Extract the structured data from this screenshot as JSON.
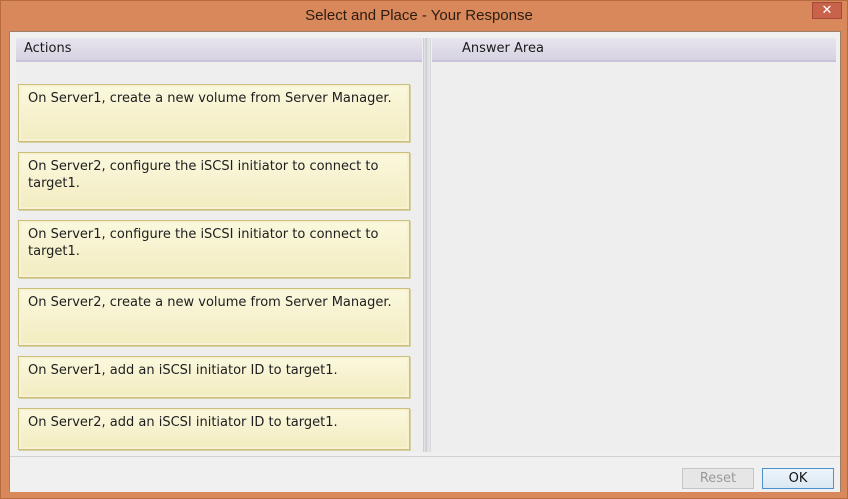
{
  "window": {
    "title": "Select and Place - Your Response",
    "close_glyph": "✕"
  },
  "actions_panel": {
    "header": "Actions",
    "items": [
      {
        "label": "On Server1, create a new volume from Server Manager."
      },
      {
        "label": "On Server2, configure the iSCSI initiator to connect to target1."
      },
      {
        "label": "On Server1, configure the iSCSI initiator to connect to target1."
      },
      {
        "label": "On Server2, create a new volume from Server Manager."
      },
      {
        "label": "On Server1, add an iSCSI initiator ID to target1."
      },
      {
        "label": "On Server2, add an iSCSI initiator ID to target1."
      }
    ]
  },
  "answer_panel": {
    "header": "Answer Area"
  },
  "footer": {
    "reset_label": "Reset",
    "ok_label": "OK"
  }
}
